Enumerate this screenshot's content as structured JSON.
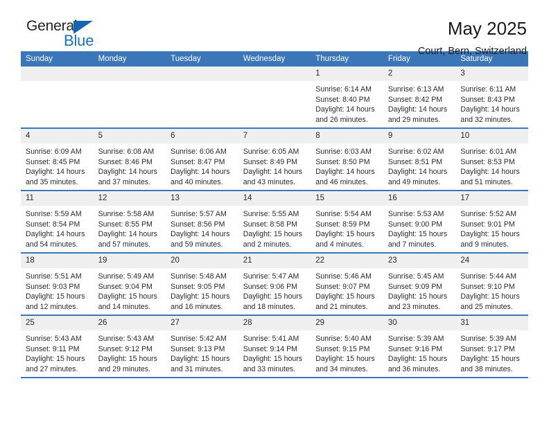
{
  "logo": {
    "word_top": "General",
    "word_bottom": "Blue",
    "triangle_color": "#1565b0",
    "blue_text_color": "#1a72bd"
  },
  "header": {
    "title": "May 2025",
    "subtitle": "Court, Bern, Switzerland"
  },
  "theme": {
    "header_blue": "#3a76b8",
    "daynum_gray": "#efefef"
  },
  "weekday_headers": [
    "Sunday",
    "Monday",
    "Tuesday",
    "Wednesday",
    "Thursday",
    "Friday",
    "Saturday"
  ],
  "weeks": [
    [
      {
        "day": "",
        "lines": []
      },
      {
        "day": "",
        "lines": []
      },
      {
        "day": "",
        "lines": []
      },
      {
        "day": "",
        "lines": []
      },
      {
        "day": "1",
        "lines": [
          "Sunrise: 6:14 AM",
          "Sunset: 8:40 PM",
          "Daylight: 14 hours",
          "and 26 minutes."
        ]
      },
      {
        "day": "2",
        "lines": [
          "Sunrise: 6:13 AM",
          "Sunset: 8:42 PM",
          "Daylight: 14 hours",
          "and 29 minutes."
        ]
      },
      {
        "day": "3",
        "lines": [
          "Sunrise: 6:11 AM",
          "Sunset: 8:43 PM",
          "Daylight: 14 hours",
          "and 32 minutes."
        ]
      }
    ],
    [
      {
        "day": "4",
        "lines": [
          "Sunrise: 6:09 AM",
          "Sunset: 8:45 PM",
          "Daylight: 14 hours",
          "and 35 minutes."
        ]
      },
      {
        "day": "5",
        "lines": [
          "Sunrise: 6:08 AM",
          "Sunset: 8:46 PM",
          "Daylight: 14 hours",
          "and 37 minutes."
        ]
      },
      {
        "day": "6",
        "lines": [
          "Sunrise: 6:06 AM",
          "Sunset: 8:47 PM",
          "Daylight: 14 hours",
          "and 40 minutes."
        ]
      },
      {
        "day": "7",
        "lines": [
          "Sunrise: 6:05 AM",
          "Sunset: 8:49 PM",
          "Daylight: 14 hours",
          "and 43 minutes."
        ]
      },
      {
        "day": "8",
        "lines": [
          "Sunrise: 6:03 AM",
          "Sunset: 8:50 PM",
          "Daylight: 14 hours",
          "and 46 minutes."
        ]
      },
      {
        "day": "9",
        "lines": [
          "Sunrise: 6:02 AM",
          "Sunset: 8:51 PM",
          "Daylight: 14 hours",
          "and 49 minutes."
        ]
      },
      {
        "day": "10",
        "lines": [
          "Sunrise: 6:01 AM",
          "Sunset: 8:53 PM",
          "Daylight: 14 hours",
          "and 51 minutes."
        ]
      }
    ],
    [
      {
        "day": "11",
        "lines": [
          "Sunrise: 5:59 AM",
          "Sunset: 8:54 PM",
          "Daylight: 14 hours",
          "and 54 minutes."
        ]
      },
      {
        "day": "12",
        "lines": [
          "Sunrise: 5:58 AM",
          "Sunset: 8:55 PM",
          "Daylight: 14 hours",
          "and 57 minutes."
        ]
      },
      {
        "day": "13",
        "lines": [
          "Sunrise: 5:57 AM",
          "Sunset: 8:56 PM",
          "Daylight: 14 hours",
          "and 59 minutes."
        ]
      },
      {
        "day": "14",
        "lines": [
          "Sunrise: 5:55 AM",
          "Sunset: 8:58 PM",
          "Daylight: 15 hours",
          "and 2 minutes."
        ]
      },
      {
        "day": "15",
        "lines": [
          "Sunrise: 5:54 AM",
          "Sunset: 8:59 PM",
          "Daylight: 15 hours",
          "and 4 minutes."
        ]
      },
      {
        "day": "16",
        "lines": [
          "Sunrise: 5:53 AM",
          "Sunset: 9:00 PM",
          "Daylight: 15 hours",
          "and 7 minutes."
        ]
      },
      {
        "day": "17",
        "lines": [
          "Sunrise: 5:52 AM",
          "Sunset: 9:01 PM",
          "Daylight: 15 hours",
          "and 9 minutes."
        ]
      }
    ],
    [
      {
        "day": "18",
        "lines": [
          "Sunrise: 5:51 AM",
          "Sunset: 9:03 PM",
          "Daylight: 15 hours",
          "and 12 minutes."
        ]
      },
      {
        "day": "19",
        "lines": [
          "Sunrise: 5:49 AM",
          "Sunset: 9:04 PM",
          "Daylight: 15 hours",
          "and 14 minutes."
        ]
      },
      {
        "day": "20",
        "lines": [
          "Sunrise: 5:48 AM",
          "Sunset: 9:05 PM",
          "Daylight: 15 hours",
          "and 16 minutes."
        ]
      },
      {
        "day": "21",
        "lines": [
          "Sunrise: 5:47 AM",
          "Sunset: 9:06 PM",
          "Daylight: 15 hours",
          "and 18 minutes."
        ]
      },
      {
        "day": "22",
        "lines": [
          "Sunrise: 5:46 AM",
          "Sunset: 9:07 PM",
          "Daylight: 15 hours",
          "and 21 minutes."
        ]
      },
      {
        "day": "23",
        "lines": [
          "Sunrise: 5:45 AM",
          "Sunset: 9:09 PM",
          "Daylight: 15 hours",
          "and 23 minutes."
        ]
      },
      {
        "day": "24",
        "lines": [
          "Sunrise: 5:44 AM",
          "Sunset: 9:10 PM",
          "Daylight: 15 hours",
          "and 25 minutes."
        ]
      }
    ],
    [
      {
        "day": "25",
        "lines": [
          "Sunrise: 5:43 AM",
          "Sunset: 9:11 PM",
          "Daylight: 15 hours",
          "and 27 minutes."
        ]
      },
      {
        "day": "26",
        "lines": [
          "Sunrise: 5:43 AM",
          "Sunset: 9:12 PM",
          "Daylight: 15 hours",
          "and 29 minutes."
        ]
      },
      {
        "day": "27",
        "lines": [
          "Sunrise: 5:42 AM",
          "Sunset: 9:13 PM",
          "Daylight: 15 hours",
          "and 31 minutes."
        ]
      },
      {
        "day": "28",
        "lines": [
          "Sunrise: 5:41 AM",
          "Sunset: 9:14 PM",
          "Daylight: 15 hours",
          "and 33 minutes."
        ]
      },
      {
        "day": "29",
        "lines": [
          "Sunrise: 5:40 AM",
          "Sunset: 9:15 PM",
          "Daylight: 15 hours",
          "and 34 minutes."
        ]
      },
      {
        "day": "30",
        "lines": [
          "Sunrise: 5:39 AM",
          "Sunset: 9:16 PM",
          "Daylight: 15 hours",
          "and 36 minutes."
        ]
      },
      {
        "day": "31",
        "lines": [
          "Sunrise: 5:39 AM",
          "Sunset: 9:17 PM",
          "Daylight: 15 hours",
          "and 38 minutes."
        ]
      }
    ]
  ]
}
